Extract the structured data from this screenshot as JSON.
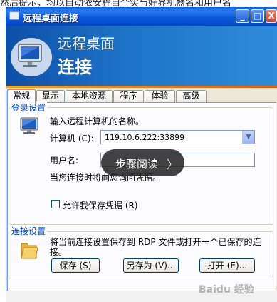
{
  "top_strip_text": "然后提示，均以自动依安程自个实与好界机器名和用户名",
  "window": {
    "title": "远程桌面连接",
    "min_label": "_",
    "max_label": "□",
    "close_label": "X"
  },
  "banner": {
    "line1": "远程桌面",
    "line2": "连接"
  },
  "tabs": [
    {
      "label": "常规"
    },
    {
      "label": "显示"
    },
    {
      "label": "本地资源"
    },
    {
      "label": "程序"
    },
    {
      "label": "体验"
    },
    {
      "label": "高级"
    }
  ],
  "login": {
    "group_label": "登录设置",
    "instruction": "输入远程计算机的名称。",
    "computer_label": "计算机 (C):",
    "computer_value": "119.10.6.222:33899",
    "username_label": "用户名:",
    "note": "当您连接时将向您询问凭据。",
    "save_credentials_label": "允许我保存凭据 (R)"
  },
  "connection": {
    "group_label": "连接设置",
    "description": "将当前连接设置保存到 RDP 文件或打开一个已保存的连接。",
    "save_button": "保存 (S)",
    "save_as_button": "另存为 (V)...",
    "open_button": "打开 (E)..."
  },
  "overlay": {
    "label": "步骤阅读",
    "arrow": "〉"
  },
  "watermark": "Baidu 经验",
  "colors": {
    "titlebar": "#0a5bd9",
    "banner": "#1d74c9",
    "accent_rule": "#e35d11",
    "group_label": "#0046d5"
  }
}
